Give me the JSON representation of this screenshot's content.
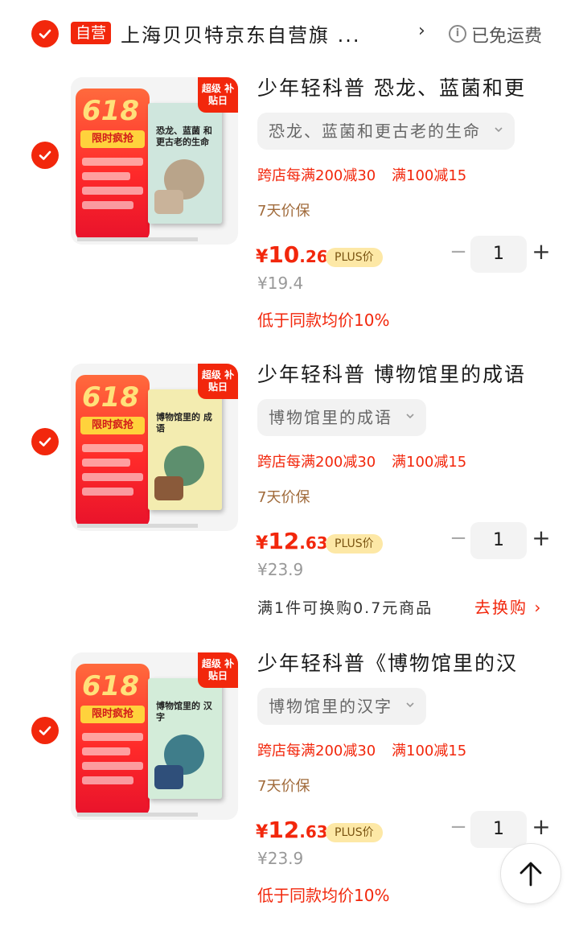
{
  "store": {
    "self_operated_tag": "自营",
    "name": "上海贝贝特京东自营旗 ...",
    "chevron": "›",
    "shipping": "已免运费"
  },
  "colors": {
    "accent": "#f2270c",
    "plus_badge_bg": "#fde8a6",
    "guarantee": "#a06a3a"
  },
  "items": [
    {
      "title": "少年轻科普 恐龙、蓝菌和更",
      "spec": "恐龙、蓝菌和更古老的生命",
      "promo": [
        "跨店每满200减30",
        "满100减15"
      ],
      "guarantee": "7天价保",
      "price_currency": "¥",
      "price_int": "10",
      "price_dec": ".26",
      "plus_label": "PLUS价",
      "original_price": "¥19.4",
      "note": "低于同款均价10%",
      "quantity": "1",
      "thumb": {
        "big": "618",
        "tag": "限时疯抢",
        "badge": "超级 补贴日",
        "book_title": "恐龙、蓝菌 和更古老的生命",
        "book_color": "#cfe6dd"
      }
    },
    {
      "title": "少年轻科普 博物馆里的成语",
      "spec": "博物馆里的成语",
      "promo": [
        "跨店每满200减30",
        "满100减15"
      ],
      "guarantee": "7天价保",
      "price_currency": "¥",
      "price_int": "12",
      "price_dec": ".63",
      "plus_label": "PLUS价",
      "original_price": "¥23.9",
      "swap_text": "满1件可换购0.7元商品",
      "swap_link": "去换购 ›",
      "quantity": "1",
      "thumb": {
        "big": "618",
        "tag": "限时疯抢",
        "badge": "超级 补贴日",
        "book_title": "博物馆里的 成语",
        "book_color": "#f3ecb0"
      }
    },
    {
      "title": "少年轻科普《博物馆里的汉",
      "spec": "博物馆里的汉字",
      "promo": [
        "跨店每满200减30",
        "满100减15"
      ],
      "guarantee": "7天价保",
      "price_currency": "¥",
      "price_int": "12",
      "price_dec": ".63",
      "plus_label": "PLUS价",
      "original_price": "¥23.9",
      "note": "低于同款均价10%",
      "quantity": "1",
      "thumb": {
        "big": "618",
        "tag": "限时疯抢",
        "badge": "超级 补贴日",
        "book_title": "博物馆里的 汉字",
        "book_color": "#d3ecd9"
      }
    }
  ],
  "controls": {
    "minus": "−",
    "plus": "+"
  },
  "icons": {
    "check": "check-icon",
    "info": "info-icon",
    "chevron": "chevron-down-icon",
    "back_to_top": "arrow-up-icon"
  }
}
